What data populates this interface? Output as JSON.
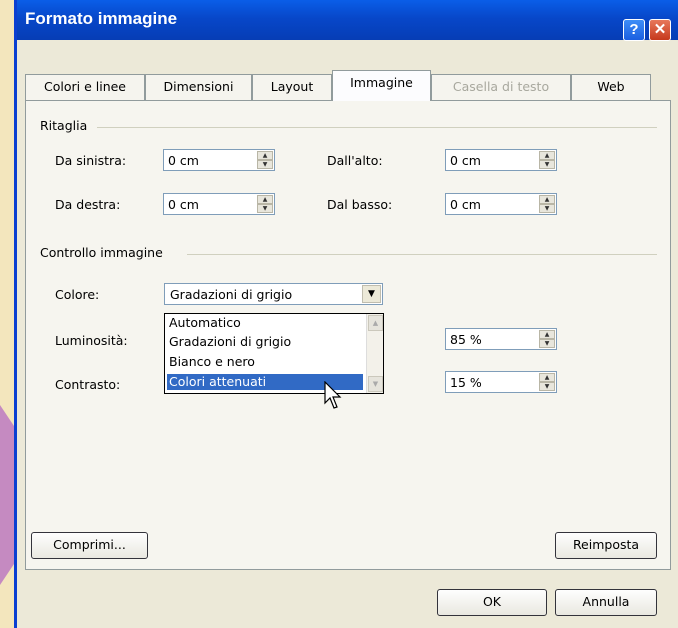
{
  "window": {
    "title": "Formato immagine",
    "help_icon": "?",
    "close_icon": "✕"
  },
  "tabs": [
    {
      "label": "Colori e linee",
      "state": "normal"
    },
    {
      "label": "Dimensioni",
      "state": "normal"
    },
    {
      "label": "Layout",
      "state": "normal"
    },
    {
      "label": "Immagine",
      "state": "active"
    },
    {
      "label": "Casella di testo",
      "state": "disabled"
    },
    {
      "label": "Web",
      "state": "normal"
    }
  ],
  "crop": {
    "group_label": "Ritaglia",
    "left": {
      "label": "Da sinistra:",
      "value": "0 cm"
    },
    "right": {
      "label": "Da destra:",
      "value": "0 cm"
    },
    "top": {
      "label": "Dall'alto:",
      "value": "0 cm"
    },
    "bottom": {
      "label": "Dal basso:",
      "value": "0 cm"
    }
  },
  "image_control": {
    "group_label": "Controllo immagine",
    "color": {
      "label": "Colore:",
      "value": "Gradazioni di grigio",
      "options": [
        "Automatico",
        "Gradazioni di grigio",
        "Bianco e nero",
        "Colori attenuati"
      ],
      "highlighted_option": "Colori attenuati"
    },
    "brightness": {
      "label": "Luminosità:",
      "value": "85 %"
    },
    "contrast": {
      "label": "Contrasto:",
      "value": "15 %"
    }
  },
  "buttons": {
    "compress": "Comprimi...",
    "reset": "Reimposta",
    "ok": "OK",
    "cancel": "Annulla"
  },
  "colors": {
    "titlebar": "#0747c9",
    "selection": "#316ac5",
    "background_arrow": "#c58ac1"
  }
}
